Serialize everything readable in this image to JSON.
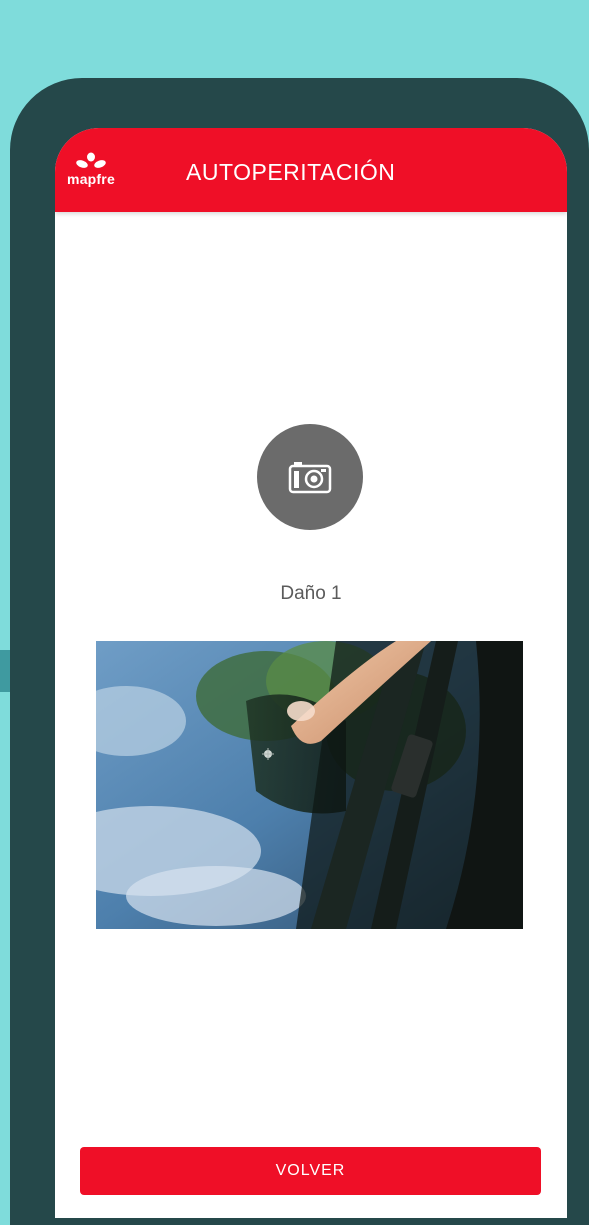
{
  "header": {
    "logo_text": "mapfre",
    "title": "AUTOPERITACIÓN"
  },
  "capture": {
    "icon": "camera-icon",
    "label": "Daño 1"
  },
  "photo": {
    "subject": "windshield-damage-photo"
  },
  "footer": {
    "back_label": "VOLVER"
  },
  "colors": {
    "brand_red": "#ef0f27",
    "background_teal": "#7fdcdb",
    "phone_frame": "#25484a",
    "icon_circle": "#6b6b6b"
  }
}
